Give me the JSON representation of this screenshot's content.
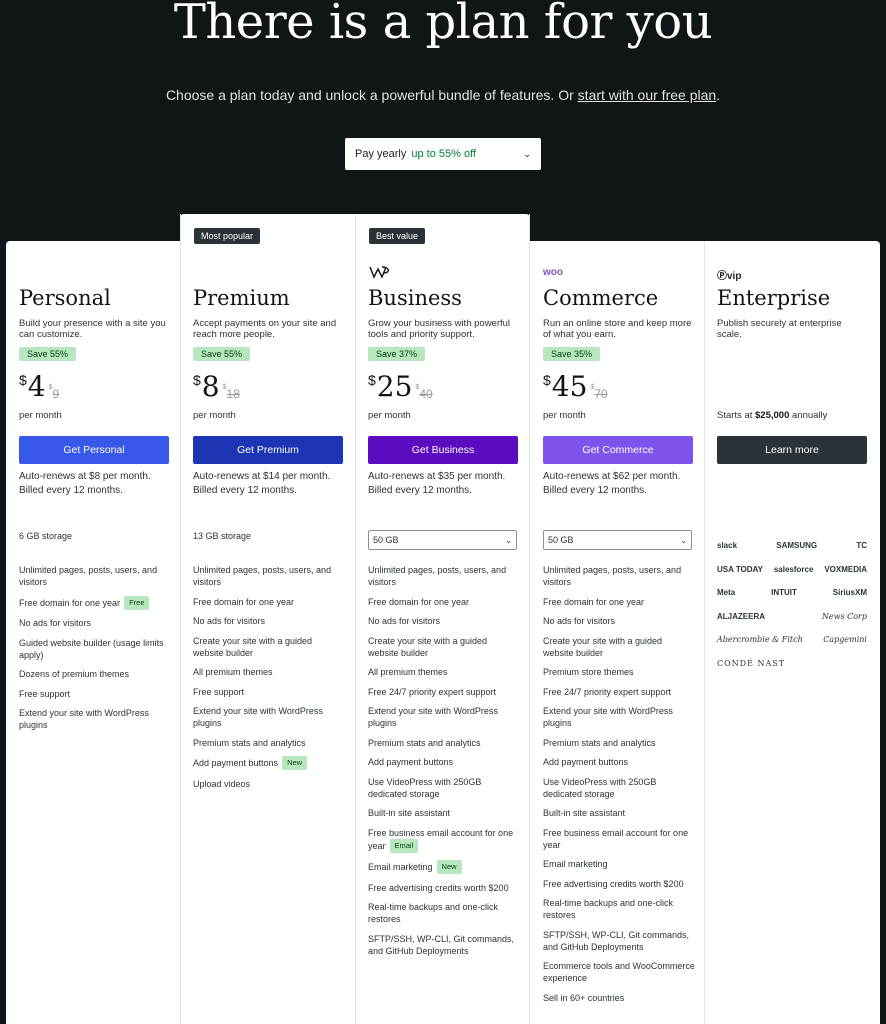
{
  "hero": {
    "title": "There is a plan for you",
    "subtitle": "Choose a plan today and unlock a powerful bundle of features. Or ",
    "free_link": "start with our free plan",
    "subtitle_end": "."
  },
  "term_select": {
    "label": "Pay yearly",
    "discount": "up to 55% off",
    "icon": "chevron-down-icon"
  },
  "badges": {
    "most_popular": "Most popular",
    "best_value": "Best value"
  },
  "logos": {
    "business": "WP",
    "commerce": "woo",
    "enterprise": "vip"
  },
  "colors": {
    "personal": "#3858e9",
    "premium": "#1d35b4",
    "business": "#5b0bc0",
    "commerce": "#7f54ed",
    "enterprise": "#2c3338",
    "save_badge": "#b8e6bf"
  },
  "plans": {
    "personal": {
      "name": "Personal",
      "desc": "Build your presence with a site you can customize.",
      "save": "Save 55%",
      "currency": "$",
      "price": "4",
      "old_currency": "$",
      "old_price": "9",
      "per": "per month",
      "cta": "Get Personal",
      "renew": "Auto-renews at $8 per month. Billed every 12 months.",
      "storage": "6 GB storage",
      "features": [
        "Unlimited pages, posts, users, and visitors",
        "Free domain for one year",
        "No ads for visitors",
        "Guided website builder (usage limits apply)",
        "Dozens of premium themes",
        "Free support",
        "Extend your site with WordPress plugins"
      ],
      "tag_free": "Free"
    },
    "premium": {
      "name": "Premium",
      "desc": "Accept payments on your site and reach more people.",
      "save": "Save 55%",
      "currency": "$",
      "price": "8",
      "old_currency": "$",
      "old_price": "18",
      "per": "per month",
      "cta": "Get Premium",
      "renew": "Auto-renews at $14 per month. Billed every 12 months.",
      "storage": "13 GB storage",
      "features": [
        "Unlimited pages, posts, users, and visitors",
        "Free domain for one year",
        "No ads for visitors",
        "Create your site with a guided website builder",
        "All premium themes",
        "Free support",
        "Extend your site with WordPress plugins",
        "Premium stats and analytics",
        "Add payment buttons",
        "Upload videos"
      ],
      "tag_new": "New"
    },
    "business": {
      "name": "Business",
      "desc": "Grow your business with powerful tools and priority support.",
      "save": "Save 37%",
      "currency": "$",
      "price": "25",
      "old_currency": "$",
      "old_price": "40",
      "per": "per month",
      "cta": "Get Business",
      "renew": "Auto-renews at $35 per month. Billed every 12 months.",
      "storage": "50 GB",
      "features": [
        "Unlimited pages, posts, users, and visitors",
        "Free domain for one year",
        "No ads for visitors",
        "Create your site with a guided website builder",
        "All premium themes",
        "Free 24/7 priority expert support",
        "Extend your site with WordPress plugins",
        "Premium stats and analytics",
        "Add payment buttons",
        "Use VideoPress with 250GB dedicated storage",
        "Built-in site assistant",
        "Free business email account for one year",
        "Email marketing",
        "Free advertising credits worth $200",
        "Real-time backups and one-click restores",
        "SFTP/SSH, WP-CLI, Git commands, and GitHub Deployments"
      ],
      "tag_email": "Email",
      "tag_new": "New"
    },
    "commerce": {
      "name": "Commerce",
      "desc": "Run an online store and keep more of what you earn.",
      "save": "Save 35%",
      "currency": "$",
      "price": "45",
      "old_currency": "$",
      "old_price": "70",
      "per": "per month",
      "cta": "Get Commerce",
      "renew": "Auto-renews at $62 per month. Billed every 12 months.",
      "storage": "50 GB",
      "features": [
        "Unlimited pages, posts, users, and visitors",
        "Free domain for one year",
        "No ads for visitors",
        "Create your site with a guided website builder",
        "Premium store themes",
        "Free 24/7 priority expert support",
        "Extend your site with WordPress plugins",
        "Premium stats and analytics",
        "Add payment buttons",
        "Use VideoPress with 250GB dedicated storage",
        "Built-in site assistant",
        "Free business email account for one year",
        "Email marketing",
        "Free advertising credits worth $200",
        "Real-time backups and one-click restores",
        "SFTP/SSH, WP-CLI, Git commands, and GitHub Deployments",
        "Ecommerce tools and WooCommerce experience",
        "Sell in 60+ countries"
      ]
    },
    "enterprise": {
      "name": "Enterprise",
      "desc": "Publish securely at enterprise scale.",
      "starts_prefix": "Starts at ",
      "starts_price": "$25,000",
      "starts_suffix": " annually",
      "cta": "Learn more",
      "customers": [
        "slack",
        "SAMSUNG",
        "TC",
        "USA TODAY",
        "salesforce",
        "VOXMEDIA",
        "Meta",
        "INTUIT",
        "SiriusXM",
        "ALJAZEERA",
        "News Corp",
        "Abercrombie & Fitch",
        "Capgemini",
        "CONDÉ NAST"
      ]
    }
  }
}
